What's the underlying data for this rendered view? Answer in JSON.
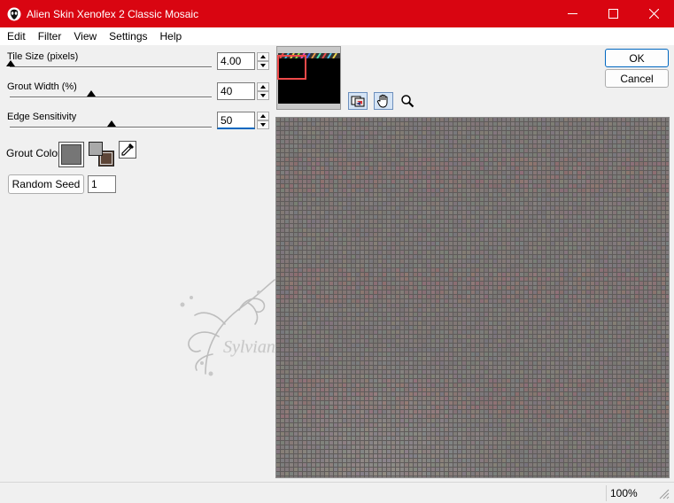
{
  "window": {
    "title": "Alien Skin Xenofex 2 Classic Mosaic",
    "minimize_glyph": "—",
    "maximize_glyph": "☐",
    "close_glyph": "✕"
  },
  "menu": [
    "Edit",
    "Filter",
    "View",
    "Settings",
    "Help"
  ],
  "params": {
    "tile_size": {
      "label": "Tile Size (pixels)",
      "value": "4.00",
      "fraction": 0.0
    },
    "grout_width": {
      "label": "Grout Width (%)",
      "value": "40",
      "fraction": 0.4
    },
    "edge_sensitivity": {
      "label": "Edge Sensitivity",
      "value": "50",
      "fraction": 0.5
    }
  },
  "grout_color": {
    "label": "Grout Color",
    "main_color": "#767676",
    "foreground_color": "#a9a9a9",
    "background_color": "#5d4537"
  },
  "random_seed": {
    "button_label": "Random Seed",
    "value": "1"
  },
  "buttons": {
    "ok": "OK",
    "cancel": "Cancel"
  },
  "watermark": {
    "text": "Sylviane"
  },
  "status": {
    "zoom": "100%"
  },
  "colors": {
    "titlebar": "#d90511",
    "preview_base": "#7a7675",
    "thumbnail_selector": "#ef4a4a"
  }
}
